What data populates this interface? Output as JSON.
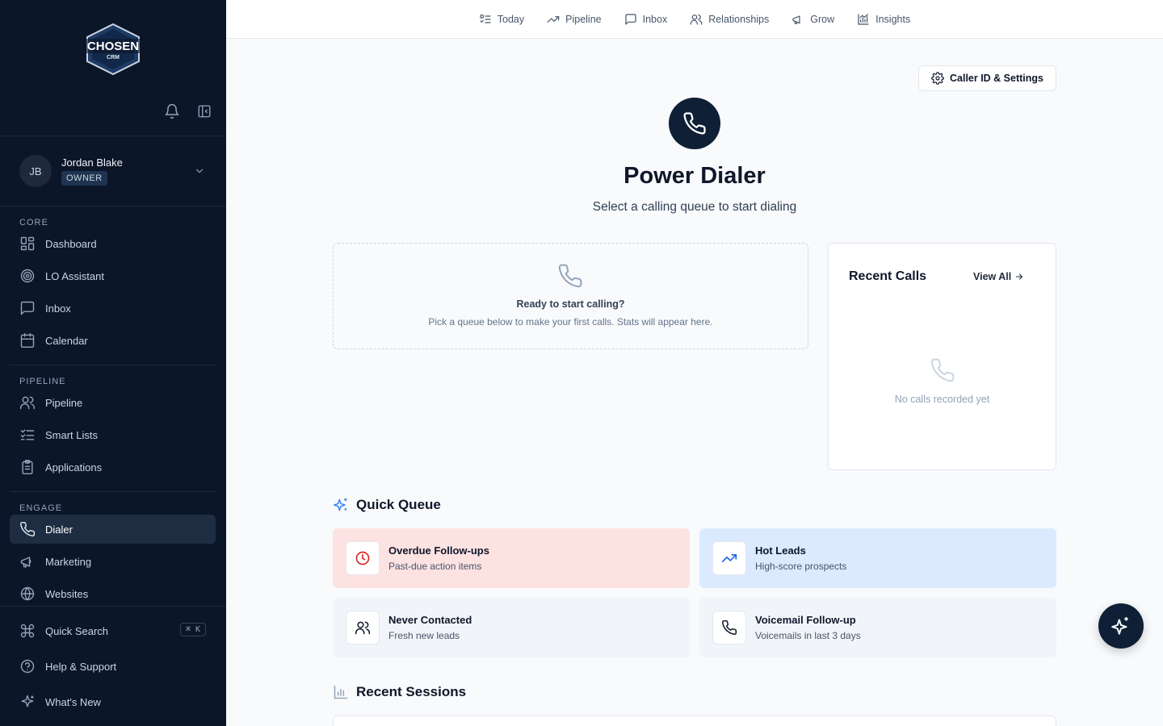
{
  "brand": {
    "name": "CHOSEN",
    "sub": "CRM"
  },
  "user": {
    "initials": "JB",
    "name": "Jordan Blake",
    "role": "OWNER"
  },
  "sidebar": {
    "sections": {
      "core": "CORE",
      "pipeline": "PIPELINE",
      "engage": "ENGAGE"
    },
    "items": {
      "dashboard": "Dashboard",
      "lo_assistant": "LO Assistant",
      "inbox": "Inbox",
      "calendar": "Calendar",
      "pipeline": "Pipeline",
      "smart_lists": "Smart Lists",
      "applications": "Applications",
      "dialer": "Dialer",
      "marketing": "Marketing",
      "websites": "Websites"
    },
    "footer": {
      "quick_search": "Quick Search",
      "quick_search_kbd": "⌘ K",
      "help": "Help & Support",
      "whats_new": "What's New"
    }
  },
  "topnav": {
    "today": "Today",
    "pipeline": "Pipeline",
    "inbox": "Inbox",
    "relationships": "Relationships",
    "grow": "Grow",
    "insights": "Insights"
  },
  "main": {
    "settings_button": "Caller ID & Settings",
    "title": "Power Dialer",
    "subtitle": "Select a calling queue to start dialing",
    "empty_state": {
      "title": "Ready to start calling?",
      "text": "Pick a queue below to make your first calls. Stats will appear here."
    },
    "recent_calls": {
      "title": "Recent Calls",
      "view_all": "View All",
      "empty": "No calls recorded yet"
    },
    "quick_queue": {
      "title": "Quick Queue",
      "items": [
        {
          "title": "Overdue Follow-ups",
          "sub": "Past-due action items",
          "bg": "#fde2e2",
          "icon_color": "#dc2626"
        },
        {
          "title": "Hot Leads",
          "sub": "High-score prospects",
          "bg": "#dbeafe",
          "icon_color": "#2563eb"
        },
        {
          "title": "Never Contacted",
          "sub": "Fresh new leads",
          "bg": "#f1f5f9",
          "icon_color": "#0f172a"
        },
        {
          "title": "Voicemail Follow-up",
          "sub": "Voicemails in last 3 days",
          "bg": "#f1f5f9",
          "icon_color": "#0f172a"
        }
      ]
    },
    "recent_sessions": {
      "title": "Recent Sessions"
    }
  },
  "colors": {
    "sidebar_bg": "#0b1628",
    "accent_dark": "#0f1f35",
    "sparkle_blue": "#3b82f6"
  }
}
